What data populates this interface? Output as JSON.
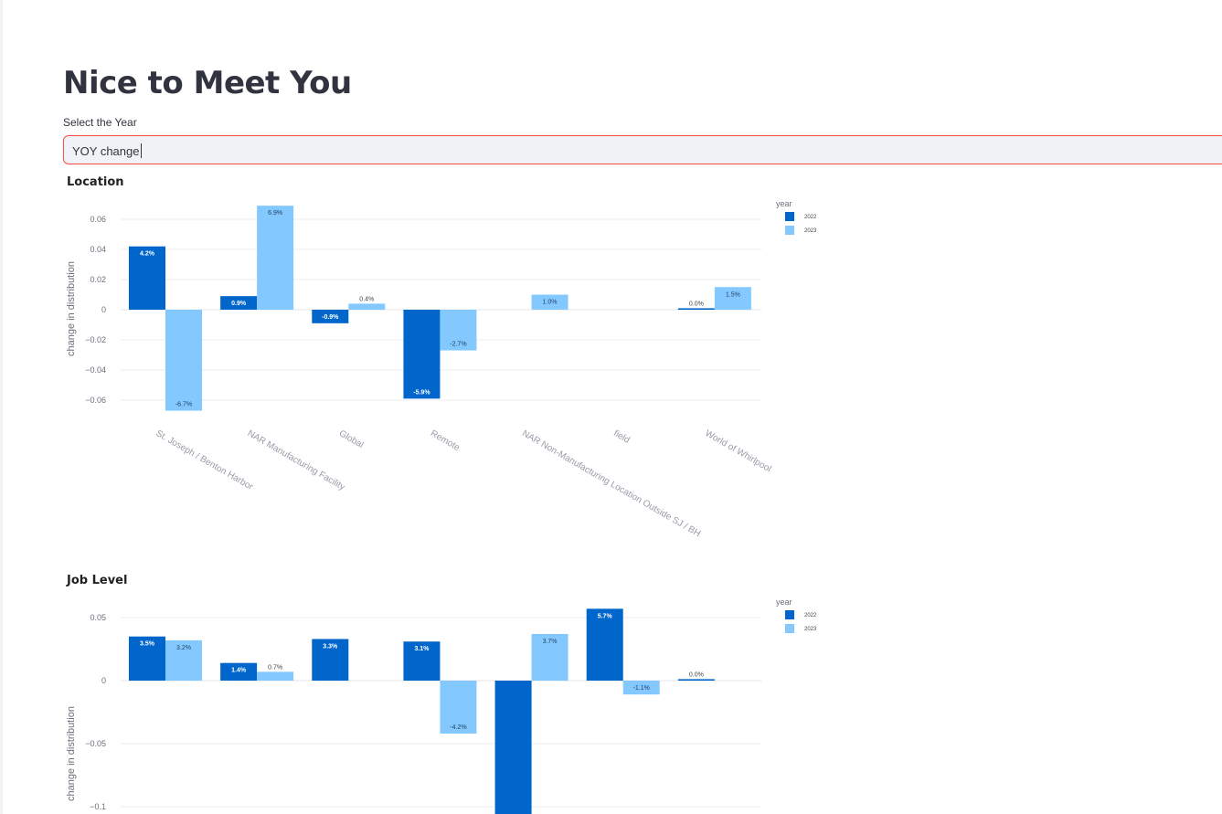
{
  "page": {
    "title": "Nice to Meet You"
  },
  "year_select": {
    "label": "Select the Year",
    "value": "YOY change"
  },
  "colors": {
    "series_2022": "#0066cc",
    "series_2023": "#83c9ff",
    "input_border": "#ff4b4b",
    "input_bg": "#f0f2f6"
  },
  "chart_data": [
    {
      "type": "bar",
      "title": "Location",
      "ylabel": "change in distribution",
      "xlabel": "",
      "ylim": [
        -0.069,
        0.07
      ],
      "yticks": [
        0.06,
        0.04,
        0.02,
        0,
        -0.02,
        -0.04,
        -0.06
      ],
      "ytick_labels": [
        "0.06",
        "0.04",
        "0.02",
        "0",
        "−0.02",
        "−0.04",
        "−0.06"
      ],
      "categories": [
        "St. Joseph / Benton Harbor",
        "NAR Manufacturing Facility",
        "Global",
        "Remote",
        "NAR Non-Manufacturing Location Outside SJ / BH",
        "field",
        "World of Whirlpool"
      ],
      "legend_title": "year",
      "legend_position": "top-right",
      "grid": true,
      "series": [
        {
          "name": "2022",
          "values": [
            0.042,
            0.009,
            -0.009,
            -0.059,
            null,
            null,
            0.0006
          ],
          "labels": [
            "4.2%",
            "0.9%",
            "-0.9%",
            "-5.9%",
            "",
            "",
            "0.0%"
          ]
        },
        {
          "name": "2023",
          "values": [
            -0.067,
            0.069,
            0.004,
            -0.027,
            0.01,
            null,
            0.015
          ],
          "labels": [
            "-6.7%",
            "6.9%",
            "0.4%",
            "-2.7%",
            "1.0%",
            "",
            "1.5%"
          ]
        }
      ]
    },
    {
      "type": "bar",
      "title": "Job Level",
      "ylabel": "change in distribution",
      "xlabel": "",
      "ylim": [
        -0.105,
        0.05
      ],
      "yticks": [
        0.05,
        0,
        -0.05,
        -0.1
      ],
      "ytick_labels": [
        "0.05",
        "0",
        "−0.05",
        "−0.1"
      ],
      "categories": [
        "",
        "",
        "",
        "",
        "",
        "",
        ""
      ],
      "legend_title": "year",
      "legend_position": "top-right",
      "grid": true,
      "series": [
        {
          "name": "2022",
          "values": [
            0.035,
            0.014,
            0.033,
            0.031,
            -0.12,
            0.057,
            0.0006
          ],
          "labels": [
            "3.5%",
            "1.4%",
            "3.3%",
            "3.1%",
            "",
            "5.7%",
            "0.0%"
          ]
        },
        {
          "name": "2023",
          "values": [
            0.032,
            0.007,
            null,
            -0.042,
            0.037,
            -0.011,
            null
          ],
          "labels": [
            "3.2%",
            "0.7%",
            "",
            "-4.2%",
            "3.7%",
            "-1.1%",
            ""
          ]
        }
      ]
    }
  ]
}
